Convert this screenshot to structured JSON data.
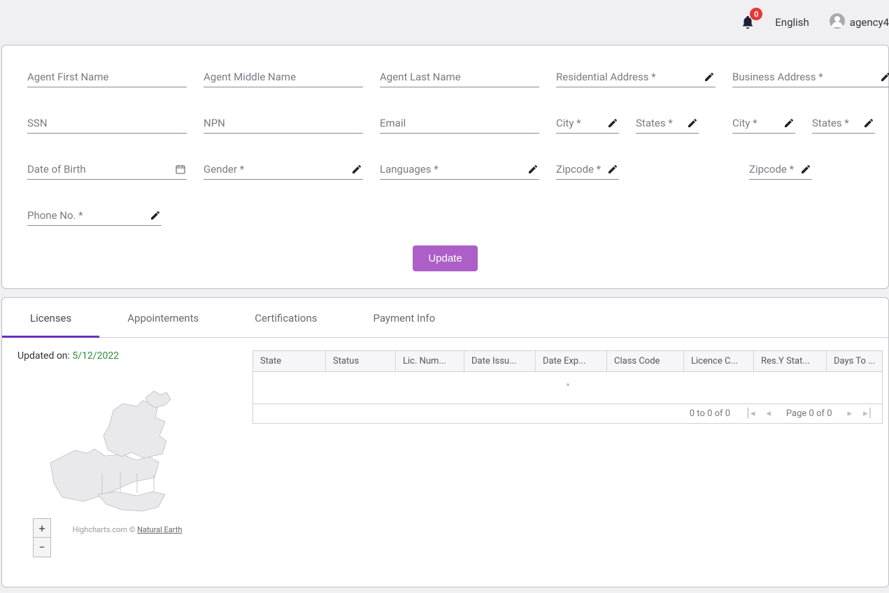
{
  "header": {
    "notification_count": "0",
    "language": "English",
    "username": "agency4"
  },
  "form": {
    "first_name": "Agent First Name",
    "middle_name": "Agent Middle Name",
    "last_name": "Agent Last Name",
    "residential_address": "Residential Address *",
    "business_address": "Business Address *",
    "ssn": "SSN",
    "npn": "NPN",
    "email": "Email",
    "res_city": "City *",
    "res_states": "States *",
    "bus_city": "City *",
    "bus_states": "States *",
    "dob": "Date of Birth",
    "gender": "Gender *",
    "languages": "Languages *",
    "res_zipcode": "Zipcode *",
    "bus_zipcode": "Zipcode *",
    "phone": "Phone No. *",
    "update_label": "Update"
  },
  "tabs": {
    "licenses": "Licenses",
    "appointments": "Appointements",
    "certifications": "Certifications",
    "payment": "Payment Info"
  },
  "licenses_tab": {
    "updated_label": "Updated on:",
    "updated_date": "5/12/2022",
    "zoom_in": "+",
    "zoom_out": "−",
    "credit_prefix": "Highcharts.com © ",
    "credit_link": "Natural Earth",
    "grid": {
      "columns": [
        "State",
        "Status",
        "Lic. Num...",
        "Date Issu...",
        "Date Exp...",
        "Class Code",
        "Licence C...",
        "Res.Y Stat...",
        "Days To ..."
      ],
      "empty": "\"",
      "range_text": "0 to 0 of 0",
      "page_text": "Page 0 of 0"
    }
  }
}
